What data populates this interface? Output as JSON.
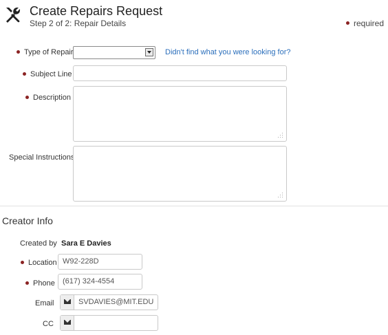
{
  "header": {
    "title": "Create Repairs Request",
    "subtitle": "Step 2 of 2: Repair Details",
    "required_legend": "required",
    "icon": "tools-icon"
  },
  "colors": {
    "required_dot": "#8b2323",
    "link": "#2a6ebb"
  },
  "repair_form": {
    "type_of_repair": {
      "label": "Type of Repair",
      "value": "",
      "required": true
    },
    "help_link": "Didn't find what you were looking for?",
    "subject_line": {
      "label": "Subject Line",
      "value": "",
      "required": true
    },
    "description": {
      "label": "Description",
      "value": "",
      "required": true
    },
    "special_instructions": {
      "label": "Special Instructions",
      "value": "",
      "required": false
    }
  },
  "creator_info": {
    "section_title": "Creator Info",
    "created_by": {
      "label": "Created by",
      "value": "Sara E Davies"
    },
    "location": {
      "label": "Location",
      "value": "W92-228D",
      "required": true
    },
    "phone": {
      "label": "Phone",
      "value": "(617) 324-4554",
      "required": true
    },
    "email": {
      "label": "Email",
      "value": "SVDAVIES@MIT.EDU",
      "icon": "envelope-icon"
    },
    "cc": {
      "label": "CC",
      "value": "",
      "icon": "envelope-icon"
    }
  }
}
